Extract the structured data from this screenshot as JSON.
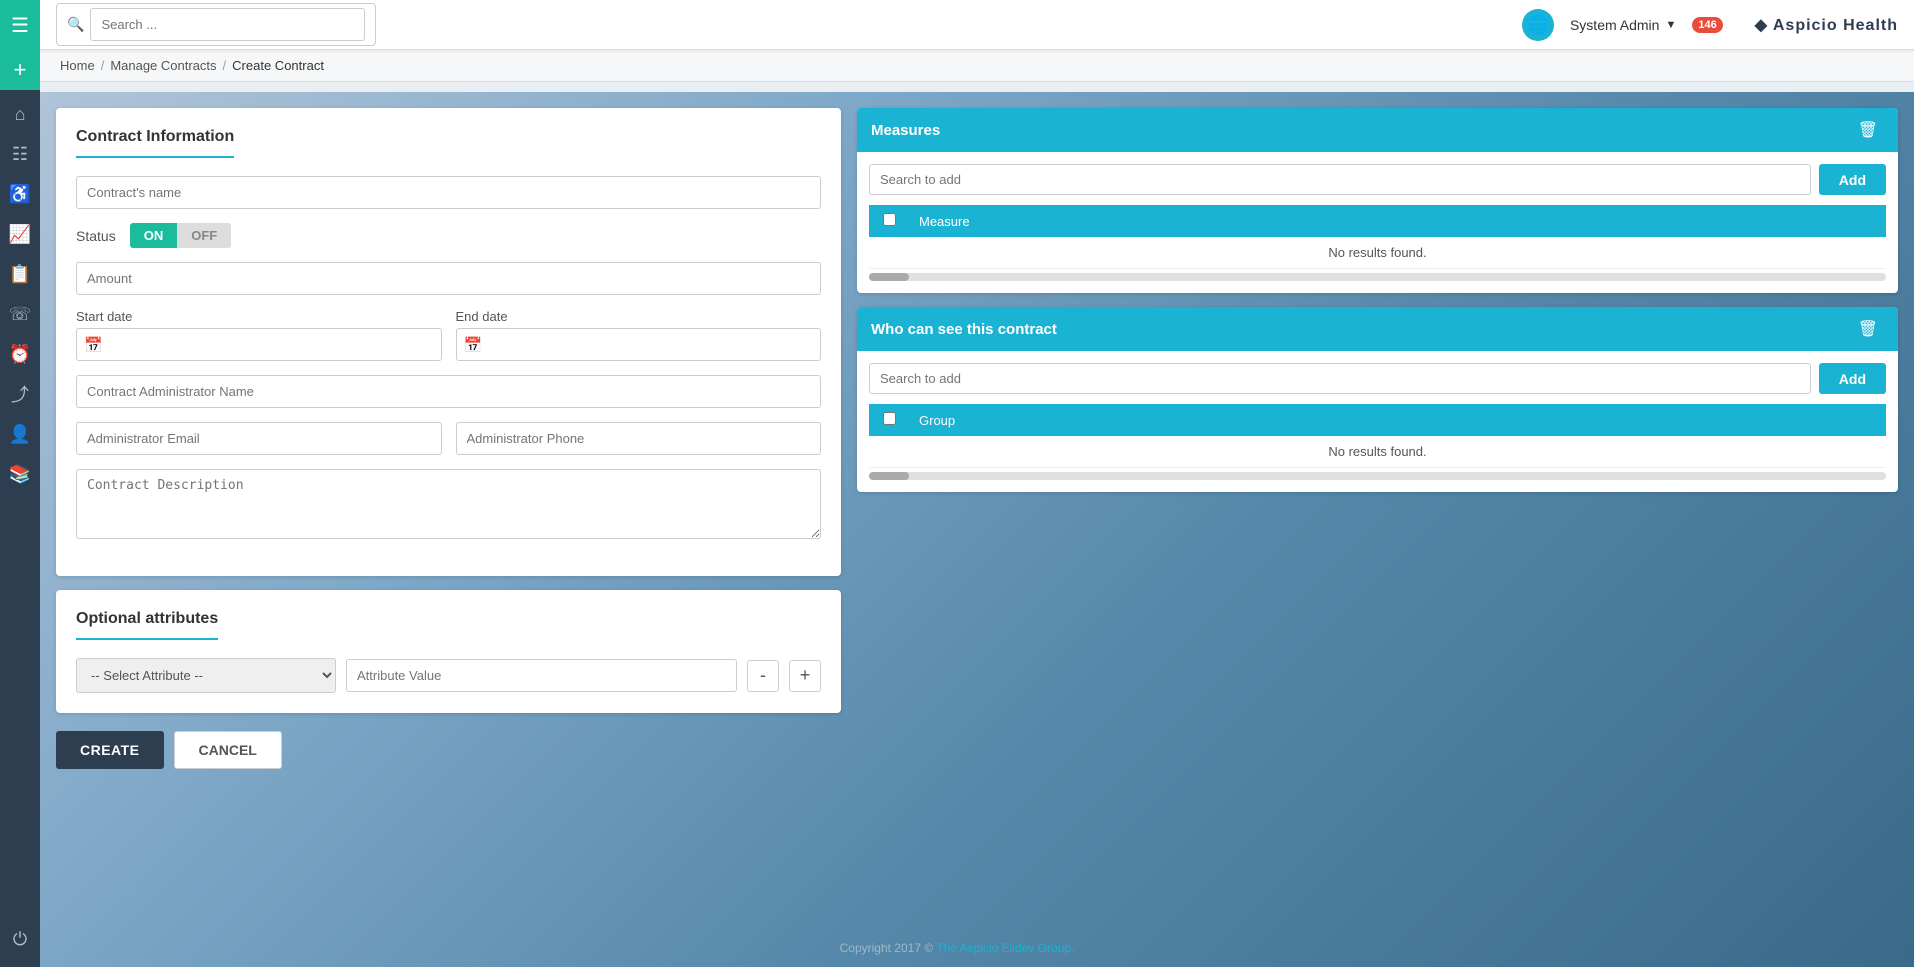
{
  "sidebar": {
    "items": [
      {
        "icon": "☰",
        "name": "menu-icon"
      },
      {
        "icon": "⊕",
        "name": "add-icon"
      },
      {
        "icon": "⌂",
        "name": "home-icon"
      },
      {
        "icon": "▦",
        "name": "grid-icon"
      },
      {
        "icon": "♿",
        "name": "accessibility-icon"
      },
      {
        "icon": "📈",
        "name": "chart-icon"
      },
      {
        "icon": "📋",
        "name": "clipboard-icon"
      },
      {
        "icon": "☎",
        "name": "phone-icon"
      },
      {
        "icon": "⏱",
        "name": "clock-icon"
      },
      {
        "icon": "⤢",
        "name": "share-icon"
      },
      {
        "icon": "👤",
        "name": "user-icon"
      },
      {
        "icon": "📚",
        "name": "stack-icon"
      },
      {
        "icon": "⏻",
        "name": "power-icon"
      }
    ]
  },
  "topnav": {
    "search_placeholder": "Search ...",
    "user_name": "System Admin",
    "notif_count": "146"
  },
  "breadcrumb": {
    "home": "Home",
    "manage_contracts": "Manage Contracts",
    "current": "Create Contract"
  },
  "contract_form": {
    "title": "Contract Information",
    "contract_name_placeholder": "Contract's name",
    "status_label": "Status",
    "status_on": "ON",
    "status_off": "OFF",
    "amount_placeholder": "Amount",
    "start_date_label": "Start date",
    "end_date_label": "End date",
    "admin_name_placeholder": "Contract Administrator Name",
    "admin_email_placeholder": "Administrator Email",
    "admin_phone_placeholder": "Administrator Phone",
    "description_placeholder": "Contract Description"
  },
  "optional_attrs": {
    "title": "Optional attributes",
    "select_placeholder": "-- Select Attribute --",
    "value_placeholder": "Attribute Value",
    "btn_minus": "-",
    "btn_plus": "+"
  },
  "actions": {
    "create_label": "CREATE",
    "cancel_label": "CANCEL"
  },
  "measures": {
    "title": "Measures",
    "search_placeholder": "Search to add",
    "add_label": "Add",
    "col_measure": "Measure",
    "no_results": "No results found."
  },
  "who_can_see": {
    "title": "Who can see this contract",
    "search_placeholder": "Search to add",
    "add_label": "Add",
    "col_group": "Group",
    "no_results": "No results found."
  },
  "copyright": {
    "text": "Copyright 2017 © ",
    "link_text": "The Aspicio Elidev Group.",
    "link_href": "#"
  }
}
